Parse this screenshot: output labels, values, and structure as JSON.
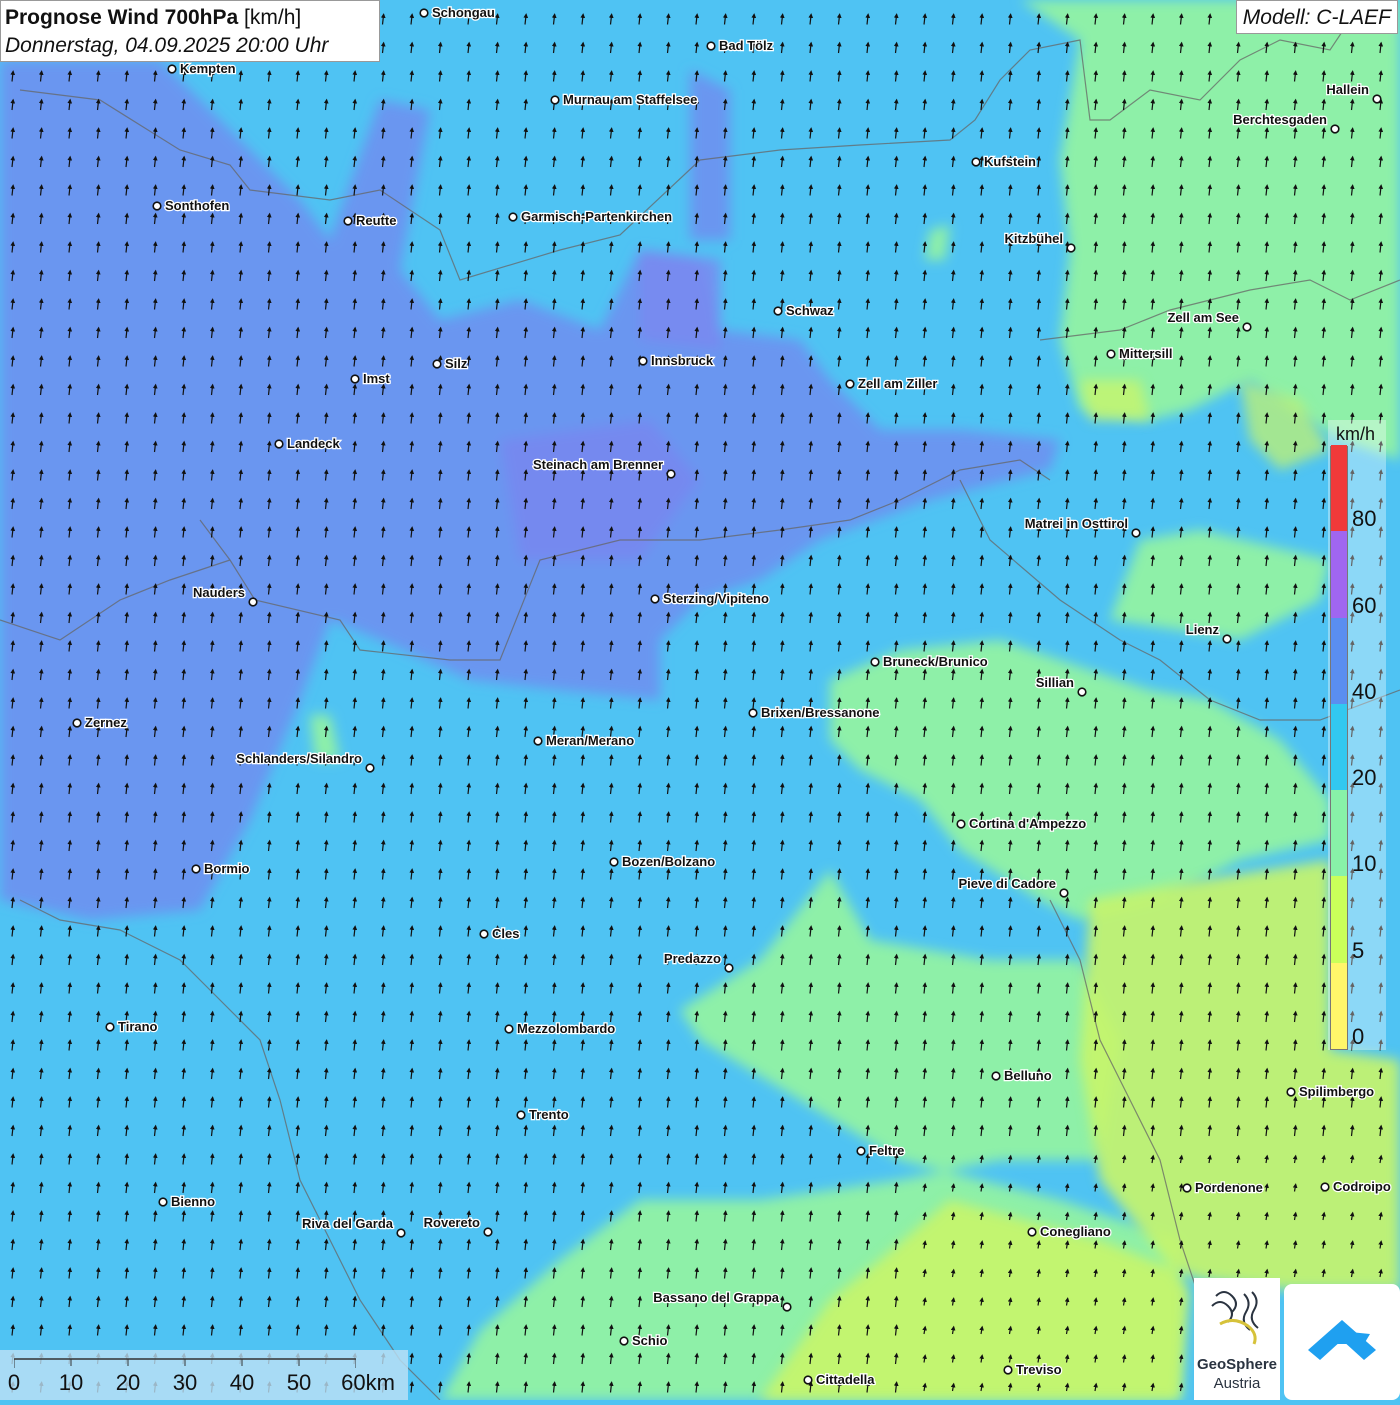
{
  "header": {
    "title_bold": "Prognose Wind 700hPa",
    "title_unit": "[km/h]",
    "subtitle": "Donnerstag, 04.09.2025 20:00 Uhr",
    "model": "Modell: C-LAEF"
  },
  "legend": {
    "unit": "km/h",
    "classes": [
      {
        "label": "0",
        "color": "#fff66a"
      },
      {
        "label": "5",
        "color": "#caff5a"
      },
      {
        "label": "10",
        "color": "#88f2a8"
      },
      {
        "label": "20",
        "color": "#32c8f0"
      },
      {
        "label": "40",
        "color": "#5a8ef0"
      },
      {
        "label": "60",
        "color": "#a066f0"
      },
      {
        "label": "80",
        "color": "#f03a3a"
      }
    ]
  },
  "scale_bar": {
    "labels": [
      "0",
      "10",
      "20",
      "30",
      "40",
      "50",
      "60km"
    ]
  },
  "places": [
    {
      "name": "Schongau"
    },
    {
      "name": "Bad Tölz"
    },
    {
      "name": "Kempten"
    },
    {
      "name": "Hallein"
    },
    {
      "name": "Murnau am Staffelsee"
    },
    {
      "name": "Berchtesgaden"
    },
    {
      "name": "Kufstein"
    },
    {
      "name": "Sonthofen"
    },
    {
      "name": "Reutte"
    },
    {
      "name": "Garmisch-Partenkirchen"
    },
    {
      "name": "Kitzbühel"
    },
    {
      "name": "Schwaz"
    },
    {
      "name": "Zell am See"
    },
    {
      "name": "Mittersill"
    },
    {
      "name": "Innsbruck"
    },
    {
      "name": "Imst"
    },
    {
      "name": "Silz"
    },
    {
      "name": "Zell am Ziller"
    },
    {
      "name": "Landeck"
    },
    {
      "name": "Steinach am Brenner"
    },
    {
      "name": "Matrei in Osttirol"
    },
    {
      "name": "Nauders"
    },
    {
      "name": "Sterzing/Vipiteno"
    },
    {
      "name": "Lienz"
    },
    {
      "name": "Bruneck/Brunico"
    },
    {
      "name": "Sillian"
    },
    {
      "name": "Brixen/Bressanone"
    },
    {
      "name": "Zernez"
    },
    {
      "name": "Meran/Merano"
    },
    {
      "name": "Schlanders/Silandro"
    },
    {
      "name": "Cortina d'Ampezzo"
    },
    {
      "name": "Bozen/Bolzano"
    },
    {
      "name": "Bormio"
    },
    {
      "name": "Pieve di Cadore"
    },
    {
      "name": "Cles"
    },
    {
      "name": "Predazzo"
    },
    {
      "name": "Tirano"
    },
    {
      "name": "Mezzolombardo"
    },
    {
      "name": "Belluno"
    },
    {
      "name": "Spilimbergo"
    },
    {
      "name": "Trento"
    },
    {
      "name": "Feltre"
    },
    {
      "name": "Pordenone"
    },
    {
      "name": "Codroipo"
    },
    {
      "name": "Bienno"
    },
    {
      "name": "Riva del Garda"
    },
    {
      "name": "Rovereto"
    },
    {
      "name": "Conegliano"
    },
    {
      "name": "Bassano del Grappa"
    },
    {
      "name": "Schio"
    },
    {
      "name": "Treviso"
    },
    {
      "name": "Cittadella"
    }
  ],
  "wind": {
    "direction": "south to north"
  },
  "logos": {
    "geosphere_line1": "GeoSphere",
    "geosphere_line2": "Austria"
  }
}
